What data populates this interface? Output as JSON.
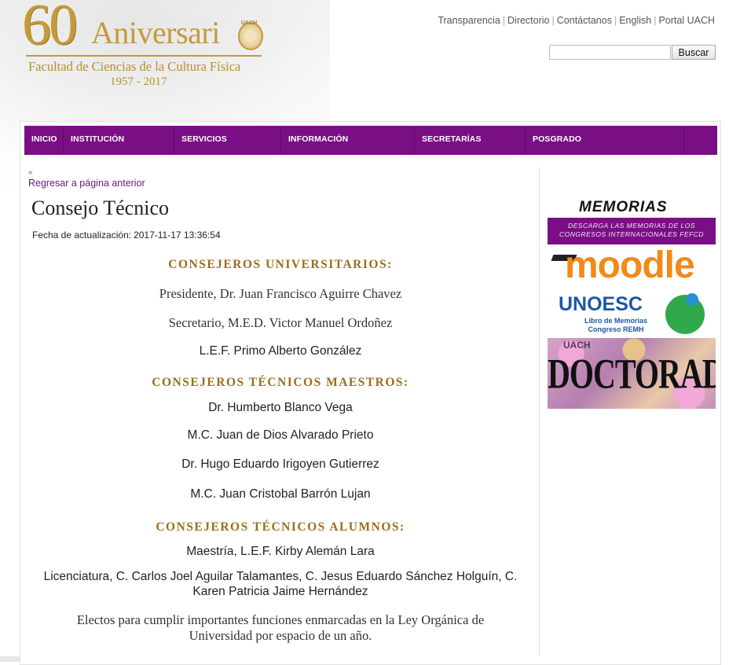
{
  "logo": {
    "sixty": "60",
    "aniversario": "Aniversari",
    "seal": "UACH",
    "faculty": "Facultad de Ciencias de la Cultura Física",
    "years": "1957 - 2017"
  },
  "toplinks": [
    "Transparencia",
    "Directorio",
    "Contáctanos",
    "English",
    "Portal UACH"
  ],
  "search": {
    "placeholder": "",
    "value": "",
    "button": "Buscar"
  },
  "nav": [
    "INICIO",
    "INSTITUCIÓN",
    "SERVICIOS",
    "INFORMACIÓN",
    "SECRETARÍAS",
    "POSGRADO"
  ],
  "back": {
    "arrow": "«",
    "label": "Regresar a página anterior"
  },
  "page": {
    "title": "Consejo Técnico",
    "updated_label": "Fecha de actualización:",
    "updated_value": "2017-11-17 13:36:54"
  },
  "sections": {
    "universitarios": {
      "heading": "CONSEJEROS UNIVERSITARIOS:",
      "members": [
        "Presidente, Dr. Juan Francisco Aguirre Chavez",
        "Secretario, M.E.D. Victor Manuel Ordoñez",
        "L.E.F. Primo Alberto González"
      ]
    },
    "maestros": {
      "heading": "CONSEJEROS TÉCNICOS MAESTROS:",
      "members": [
        "Dr. Humberto Blanco Vega",
        "M.C. Juan de Dios Alvarado Prieto",
        "Dr. Hugo Eduardo Irigoyen Gutierrez",
        "M.C. Juan Cristobal Barrón Lujan"
      ]
    },
    "alumnos": {
      "heading": "CONSEJEROS TÉCNICOS ALUMNOS:",
      "members": [
        "Maestría, L.E.F. Kirby Alemán Lara",
        "Licenciatura, C. Carlos Joel Aguilar Talamantes, C. Jesus Eduardo Sánchez Holguín, C.",
        "Karen Patricia Jaime Hernández"
      ]
    }
  },
  "footer_note": {
    "line1": "Electos para cumplir importantes funciones enmarcadas en la Ley Orgánica de",
    "line2": "Universidad por espacio de un año."
  },
  "sidebar": {
    "memorias": {
      "title": "MEMORIAS",
      "line1": "DESCARGA LAS MEMORIAS DE LOS",
      "line2": "CONGRESOS INTERNACIONALES FEFCD"
    },
    "moodle": {
      "word": "moodle"
    },
    "unoesc": {
      "name": "UNOESC",
      "line1": "Libro de Memorias",
      "line2": "Congreso REMH"
    },
    "doctorado": {
      "word": "DOCTORADO",
      "mark": "UACH"
    }
  }
}
